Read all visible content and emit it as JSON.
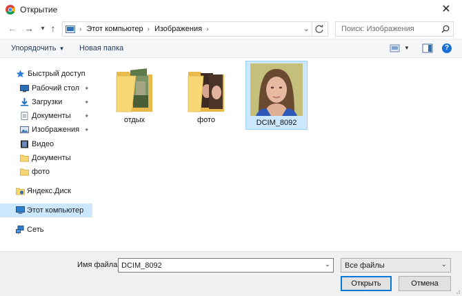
{
  "window": {
    "title": "Открытие",
    "close_glyph": "✕",
    "icon": "chrome-icon"
  },
  "nav": {
    "back_glyph": "←",
    "forward_glyph": "→",
    "recent_glyph": "▾",
    "up_glyph": "↑",
    "breadcrumbs": [
      "Этот компьютер",
      "Изображения"
    ],
    "sep_glyph": "›",
    "search_placeholder": "Поиск: Изображения"
  },
  "toolbar": {
    "organize_label": "Упорядочить",
    "new_folder_label": "Новая папка",
    "help_glyph": "?"
  },
  "sidebar": {
    "items": [
      {
        "label": "Быстрый доступ",
        "icon": "star-icon",
        "pinned": false
      },
      {
        "label": "Рабочий стол",
        "icon": "desktop-icon",
        "pinned": true
      },
      {
        "label": "Загрузки",
        "icon": "download-icon",
        "pinned": true
      },
      {
        "label": "Документы",
        "icon": "documents-icon",
        "pinned": true
      },
      {
        "label": "Изображения",
        "icon": "pictures-icon",
        "pinned": true
      },
      {
        "label": "Видео",
        "icon": "video-icon",
        "pinned": false
      },
      {
        "label": "Документы",
        "icon": "folder-icon",
        "pinned": false
      },
      {
        "label": "фото",
        "icon": "folder-icon",
        "pinned": false
      },
      {
        "label": "Яндекс.Диск",
        "icon": "yandex-disk-icon",
        "pinned": false
      },
      {
        "label": "Этот компьютер",
        "icon": "computer-icon",
        "pinned": false
      },
      {
        "label": "Сеть",
        "icon": "network-icon",
        "pinned": false
      }
    ],
    "pin_glyph": "📌"
  },
  "files": [
    {
      "label": "отдых",
      "type": "folder"
    },
    {
      "label": "фото",
      "type": "folder"
    },
    {
      "label": "DCIM_8092",
      "type": "image",
      "selected": true
    }
  ],
  "bottom": {
    "filename_label": "Имя файла:",
    "filename_value": "DCIM_8092",
    "filetype_value": "Все файлы",
    "open_label": "Открыть",
    "cancel_label": "Отмена",
    "dd_glyph": "⌄"
  },
  "colors": {
    "accent": "#0078d7",
    "selection": "#cce8ff",
    "folder": "#f8d775"
  }
}
